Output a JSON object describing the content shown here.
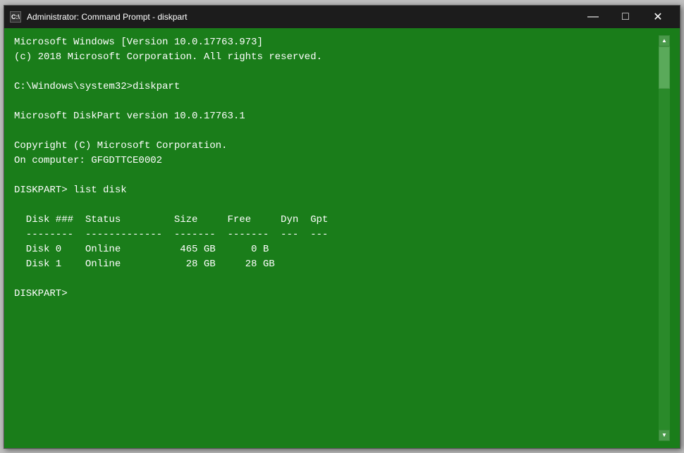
{
  "window": {
    "title": "Administrator: Command Prompt - diskpart",
    "icon_label": "C:\\",
    "controls": {
      "minimize": "—",
      "maximize": "□",
      "close": "✕"
    }
  },
  "console": {
    "lines": [
      "Microsoft Windows [Version 10.0.17763.973]",
      "(c) 2018 Microsoft Corporation. All rights reserved.",
      "",
      "C:\\Windows\\system32>diskpart",
      "",
      "Microsoft DiskPart version 10.0.17763.1",
      "",
      "Copyright (C) Microsoft Corporation.",
      "On computer: GFGDTTCE0002",
      "",
      "DISKPART> list disk",
      "",
      "  Disk ###  Status         Size     Free     Dyn  Gpt",
      "  --------  -------------  -------  -------  ---  ---",
      "  Disk 0    Online          465 GB      0 B",
      "  Disk 1    Online           28 GB     28 GB",
      "",
      "DISKPART> "
    ]
  }
}
